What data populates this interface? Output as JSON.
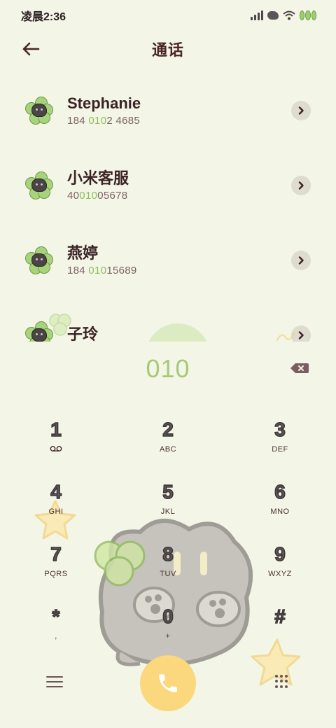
{
  "status_bar": {
    "time": "凌晨2:36",
    "icons": [
      "signal-icon",
      "blob-icon",
      "wifi-icon",
      "clover-battery-icon"
    ]
  },
  "header": {
    "title": "通话",
    "back_icon": "arrow-left-icon"
  },
  "contacts": [
    {
      "name": "Stephanie",
      "number_pre": "184 ",
      "number_match": "010",
      "number_post": "2 4685"
    },
    {
      "name": "小米客服",
      "number_pre": "40",
      "number_match": "010",
      "number_post": "05678"
    },
    {
      "name": "燕婷",
      "number_pre": "184 ",
      "number_match": "010",
      "number_post": "15689"
    },
    {
      "name": "子玲",
      "number_pre": "",
      "number_match": "",
      "number_post": ""
    }
  ],
  "dialer": {
    "input": "010",
    "keys": [
      {
        "digit": "1",
        "letters": ""
      },
      {
        "digit": "2",
        "letters": "ABC"
      },
      {
        "digit": "3",
        "letters": "DEF"
      },
      {
        "digit": "4",
        "letters": "GHI"
      },
      {
        "digit": "5",
        "letters": "JKL"
      },
      {
        "digit": "6",
        "letters": "MNO"
      },
      {
        "digit": "7",
        "letters": "PQRS"
      },
      {
        "digit": "8",
        "letters": "TUV"
      },
      {
        "digit": "9",
        "letters": "WXYZ"
      },
      {
        "digit": "*",
        "letters": ","
      },
      {
        "digit": "0",
        "letters": "+"
      },
      {
        "digit": "#",
        "letters": ""
      }
    ]
  },
  "bottom_bar": {
    "menu_icon": "hamburger-icon",
    "call_icon": "phone-icon",
    "dialpad_icon": "dialpad-grid-icon"
  },
  "colors": {
    "background": "#f3f5e6",
    "accent_green": "#8cbf5a",
    "call_button": "#fbd77d",
    "title": "#4a2628"
  }
}
